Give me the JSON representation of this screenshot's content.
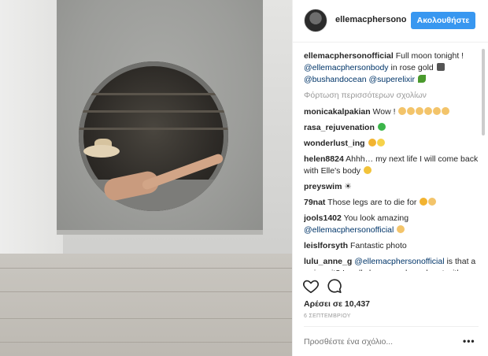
{
  "post": {
    "username": "ellemacphersono",
    "follow_label": "Ακολουθήστε"
  },
  "caption": {
    "user": "ellemacphersonofficial",
    "text1": "Full moon tonight !",
    "mention1": "@ellemacphersonbody",
    "text2": "in rose gold",
    "mention2": "@bushandocean",
    "mention3": "@superelixir"
  },
  "load_more": "Φόρτωση περισσότερων σχολίων",
  "comments": [
    {
      "user": "monicakalpakian",
      "text": "Wow !"
    },
    {
      "user": "rasa_rejuvenation",
      "text": ""
    },
    {
      "user": "wonderlust_ing",
      "text": ""
    },
    {
      "user": "helen8824",
      "text": "Ahhh… my next life I will come back with Elle's body"
    },
    {
      "user": "preyswim",
      "text": "☀"
    },
    {
      "user": "79nat",
      "text": "Those legs are to die for"
    },
    {
      "user": "jools1402",
      "text": "You look amazing"
    },
    {
      "user": "leislforsyth",
      "text": "Fantastic photo"
    },
    {
      "user": "lulu_anne_g",
      "text": "is that a swimsuit? I really hope you branch out with swimwear. I love your basic crop"
    }
  ],
  "comment_mentions": {
    "jools1402": "@ellemacphersonofficial",
    "lulu_anne_g": "@ellemacphersonofficial"
  },
  "likes": "Αρέσει σε 10,437",
  "date": "6 ΣΕΠΤΕΜΒΡΙΟΥ",
  "add_comment_placeholder": "Προσθέστε ένα σχόλιο...",
  "more_label": "•••",
  "icons": {
    "like": "heart-icon",
    "comment": "speech-bubble-icon"
  },
  "colors": {
    "accent": "#3897f0",
    "mention": "#003569"
  }
}
